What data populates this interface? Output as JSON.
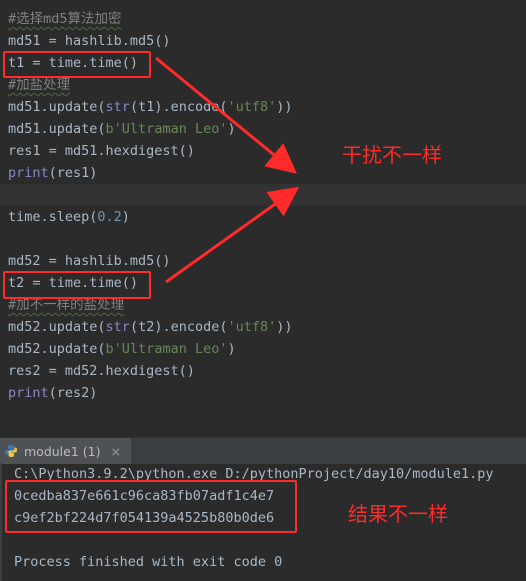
{
  "editor": {
    "lines": [
      {
        "id": "l1",
        "segments": [
          {
            "t": "#选择md5算法加密",
            "c": "cmt"
          }
        ]
      },
      {
        "id": "l2",
        "segments": [
          {
            "t": "md51 = hashlib.md5()",
            "c": ""
          }
        ]
      },
      {
        "id": "l3",
        "segments": [
          {
            "t": "t1 = time.time()",
            "c": ""
          }
        ]
      },
      {
        "id": "l4",
        "segments": [
          {
            "t": "#加盐处理",
            "c": "cmt"
          }
        ]
      },
      {
        "id": "l5",
        "segments": [
          {
            "t": "md51.update(",
            "c": ""
          },
          {
            "t": "str",
            "c": "fn"
          },
          {
            "t": "(t1).encode(",
            "c": ""
          },
          {
            "t": "'utf8'",
            "c": "str"
          },
          {
            "t": "))",
            "c": ""
          }
        ]
      },
      {
        "id": "l6",
        "segments": [
          {
            "t": "md51.update(",
            "c": ""
          },
          {
            "t": "b'Ultraman Leo'",
            "c": "str"
          },
          {
            "t": ")",
            "c": ""
          }
        ]
      },
      {
        "id": "l7",
        "segments": [
          {
            "t": "res1 = md51.hexdigest()",
            "c": ""
          }
        ]
      },
      {
        "id": "l8",
        "segments": [
          {
            "t": "print",
            "c": "fn"
          },
          {
            "t": "(res1)",
            "c": ""
          }
        ]
      },
      {
        "id": "l9",
        "segments": [
          {
            "t": "",
            "c": ""
          }
        ]
      },
      {
        "id": "l10",
        "segments": [
          {
            "t": "time.sleep(",
            "c": ""
          },
          {
            "t": "0.2",
            "c": "num"
          },
          {
            "t": ")",
            "c": ""
          }
        ]
      },
      {
        "id": "l11",
        "segments": [
          {
            "t": "",
            "c": ""
          }
        ]
      },
      {
        "id": "l12",
        "segments": [
          {
            "t": "md52 = hashlib.md5()",
            "c": ""
          }
        ]
      },
      {
        "id": "l13",
        "segments": [
          {
            "t": "t2 = time.time()",
            "c": ""
          }
        ]
      },
      {
        "id": "l14",
        "segments": [
          {
            "t": "#加不一样的盐处理",
            "c": "cmt"
          }
        ]
      },
      {
        "id": "l15",
        "segments": [
          {
            "t": "md52.update(",
            "c": ""
          },
          {
            "t": "str",
            "c": "fn"
          },
          {
            "t": "(t2).encode(",
            "c": ""
          },
          {
            "t": "'utf8'",
            "c": "str"
          },
          {
            "t": "))",
            "c": ""
          }
        ]
      },
      {
        "id": "l16",
        "segments": [
          {
            "t": "md52.update(",
            "c": ""
          },
          {
            "t": "b'Ultraman Leo'",
            "c": "str"
          },
          {
            "t": ")",
            "c": ""
          }
        ]
      },
      {
        "id": "l17",
        "segments": [
          {
            "t": "res2 = md52.hexdigest()",
            "c": ""
          }
        ]
      },
      {
        "id": "l18",
        "segments": [
          {
            "t": "print",
            "c": "fn"
          },
          {
            "t": "(res2)",
            "c": ""
          }
        ]
      }
    ]
  },
  "annotations": {
    "interference": "干扰不一样",
    "result": "结果不一样"
  },
  "run": {
    "tab_label": "module1 (1)",
    "close_glyph": "×",
    "command": "C:\\Python3.9.2\\python.exe D:/pythonProject/day10/module1.py",
    "hash1": "0cedba837e661c96ca83fb07adf1c4e7",
    "hash2": "c9ef2bf224d7f054139a4525b80b0de6",
    "exit_message": "Process finished with exit code 0"
  },
  "colors": {
    "annotation_red": "#ff2a2a",
    "editor_bg": "#2b2b2b"
  }
}
